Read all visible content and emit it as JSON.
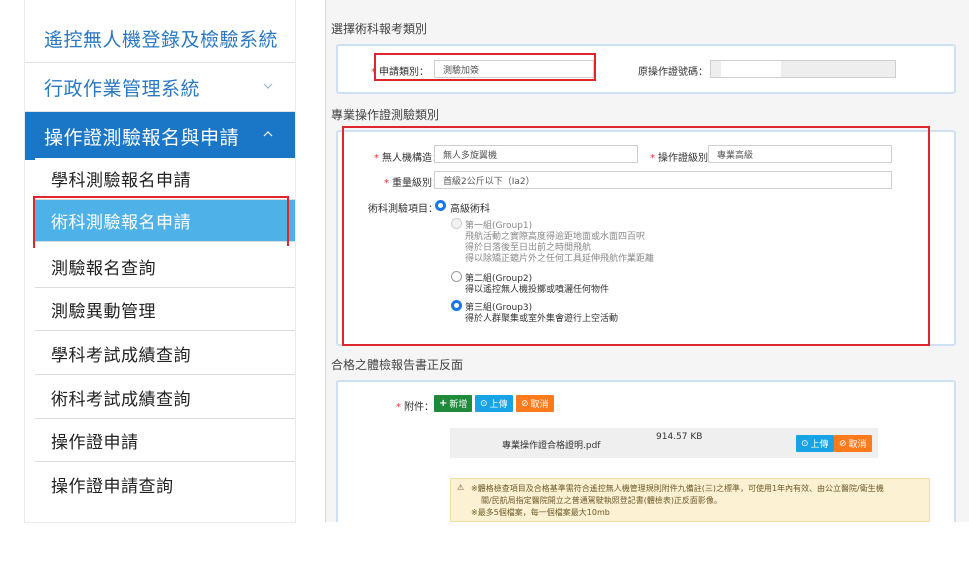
{
  "sidebar": {
    "menus": [
      {
        "label": "遙控無人機登錄及檢驗系統",
        "icon": "chevron-down-icon"
      },
      {
        "label": "行政作業管理系統",
        "icon": "chevron-down-icon"
      },
      {
        "label": "操作證測驗報名與申請",
        "icon": "chevron-up-icon",
        "active": true
      }
    ],
    "sub_items": [
      {
        "label": "學科測驗報名申請"
      },
      {
        "label": "術科測驗報名申請",
        "selected": true
      },
      {
        "label": "測驗報名查詢"
      },
      {
        "label": "測驗異動管理"
      },
      {
        "label": "學科考試成績查詢"
      },
      {
        "label": "術科考試成績查詢"
      },
      {
        "label": "操作證申請"
      },
      {
        "label": "操作證申請查詢"
      }
    ]
  },
  "section1": {
    "title": "選擇術科報考類別",
    "apply_type_label": "申請類別：",
    "apply_type_value": "測驗加簽",
    "original_cert_label": "原操作證號碼：",
    "original_cert_value": ""
  },
  "section2": {
    "title": "專業操作證測驗類別",
    "structure_label": "無人機構造：",
    "structure_value": "無人多旋翼機",
    "cert_level_label": "操作證級別：",
    "cert_level_value": "專業高級",
    "weight_label": "重量級別：",
    "weight_value": "首級2公斤以下（Ia2）",
    "exam_items_label": "術科測驗項目：",
    "advanced_label": "高級術科",
    "groups": [
      {
        "title": "第一組(Group1)",
        "lines": [
          "飛航活動之實際高度得逾距地面或水面四百呎",
          "得於日落後至日出前之時間飛航",
          "得以除矯正鏡片外之任何工具延伸飛航作業距離"
        ],
        "disabled": true,
        "checked": false
      },
      {
        "title": "第二組(Group2)",
        "lines": [
          "得以遙控無人機投擲或噴灑任何物件"
        ],
        "disabled": false,
        "checked": false
      },
      {
        "title": "第三組(Group3)",
        "lines": [
          "得於人群聚集或室外集會遊行上空活動"
        ],
        "disabled": false,
        "checked": true
      }
    ]
  },
  "section3": {
    "title": "合格之體檢報告書正反面",
    "attach_label": "附件：",
    "add_button": "新增",
    "upload_button": "上傳",
    "cancel_button": "取消",
    "file_name": "專業操作證合格證明.pdf",
    "file_size": "914.57 KB",
    "notice_lines": [
      "※體格檢查項目及合格基準需符合遙控無人機管理規則附件九備註(三)之標準，可使用1年內有效、由公立醫院/衛生機",
      "關/民航局指定醫院開立之普通駕駛執照登記書(體檢表)正反面影像。",
      "※最多5個檔案，每一個檔案最大10mb"
    ]
  },
  "colors": {
    "brand_blue": "#1a76c6",
    "selected_blue": "#4eb1e8",
    "highlight_red": "#e0262d",
    "req_red": "#e33333"
  }
}
